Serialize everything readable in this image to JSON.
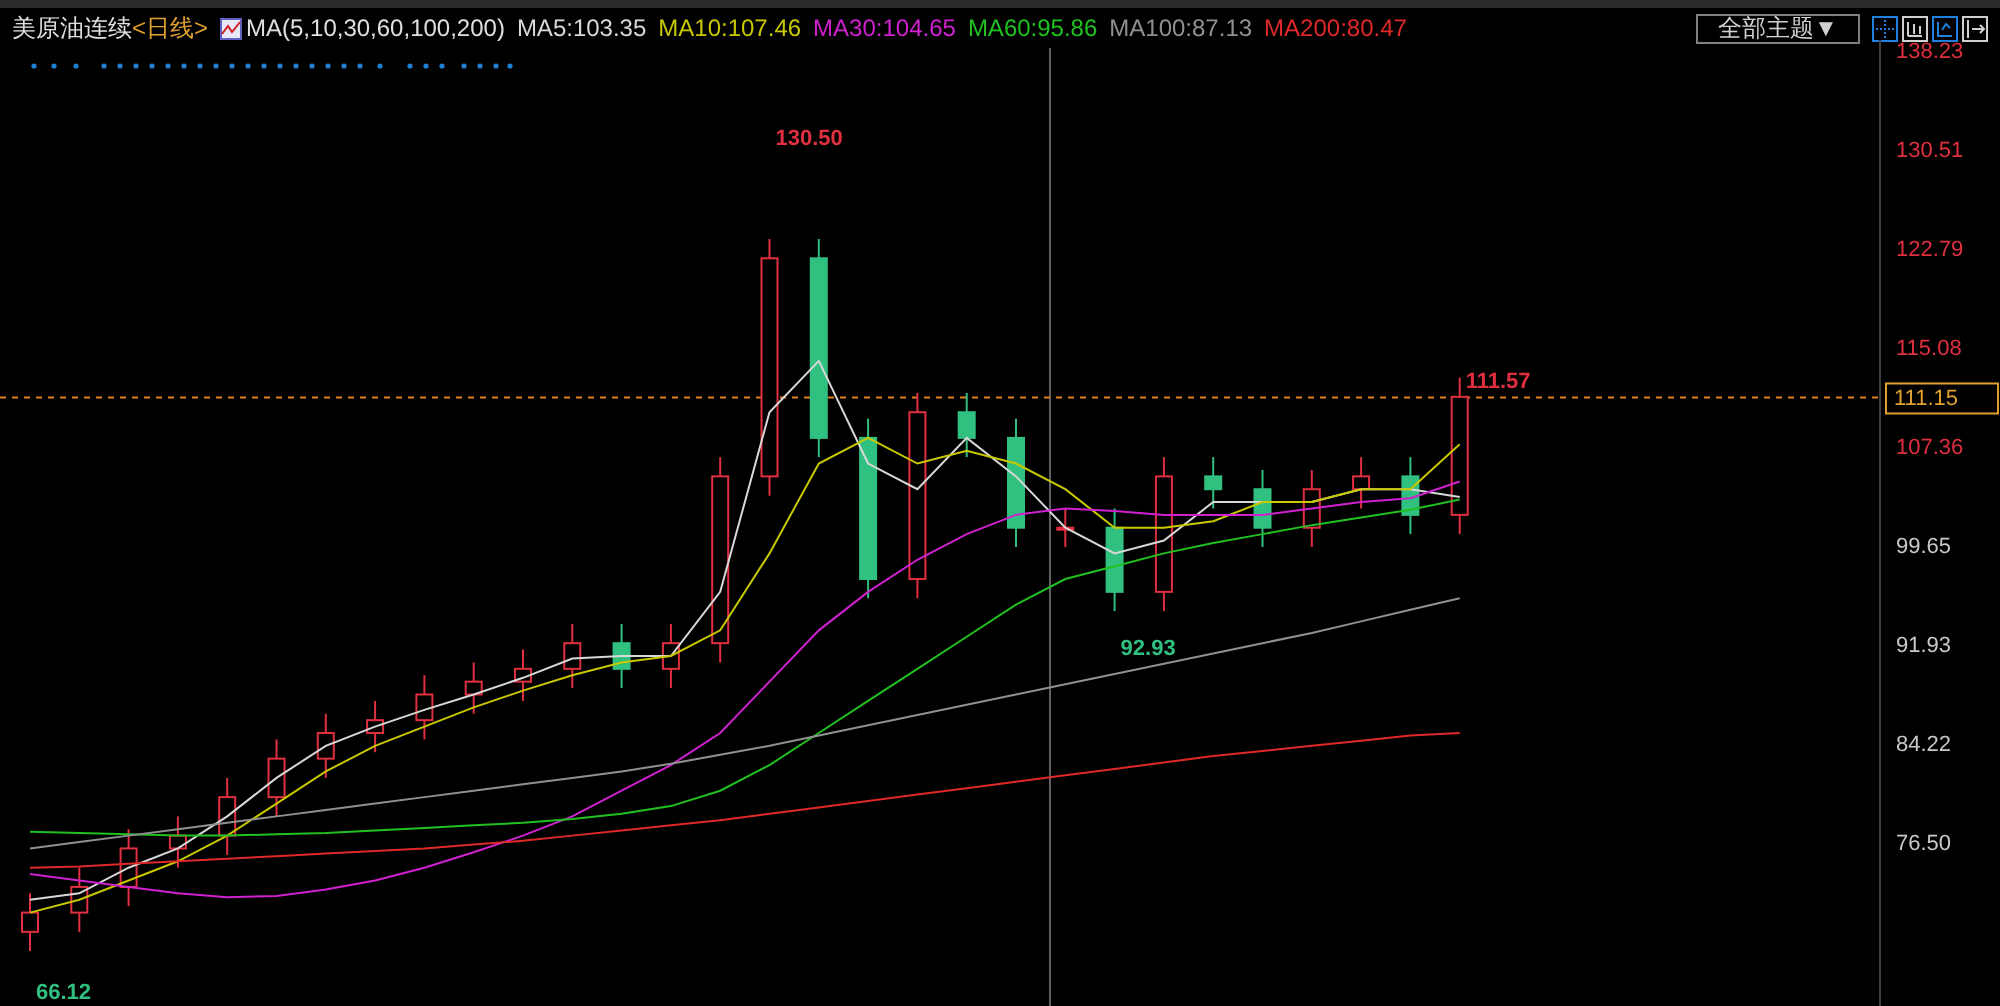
{
  "header": {
    "instrument": "美原油连续",
    "period": "<日线>",
    "indicator": "MA(5,10,30,60,100,200)",
    "legend": [
      {
        "label": "MA5:103.35",
        "color": "#d8d8d8"
      },
      {
        "label": "MA10:107.46",
        "color": "#c8c800"
      },
      {
        "label": "MA30:104.65",
        "color": "#d020d0"
      },
      {
        "label": "MA60:95.86",
        "color": "#20c020"
      },
      {
        "label": "MA100:87.13",
        "color": "#909090"
      },
      {
        "label": "MA200:80.47",
        "color": "#e02828"
      }
    ],
    "theme_dropdown": "全部主题▼"
  },
  "price_axis": [
    "138.23",
    "130.51",
    "122.79",
    "115.08",
    "107.36",
    "99.65",
    "91.93",
    "84.22",
    "76.50"
  ],
  "price_marks": [
    {
      "label": "66.12",
      "kind": "low"
    },
    {
      "label": "130.50",
      "kind": "high"
    },
    {
      "label": "92.93",
      "kind": "low"
    },
    {
      "label": "111.57",
      "kind": "high"
    }
  ],
  "last_price": "111.15"
}
